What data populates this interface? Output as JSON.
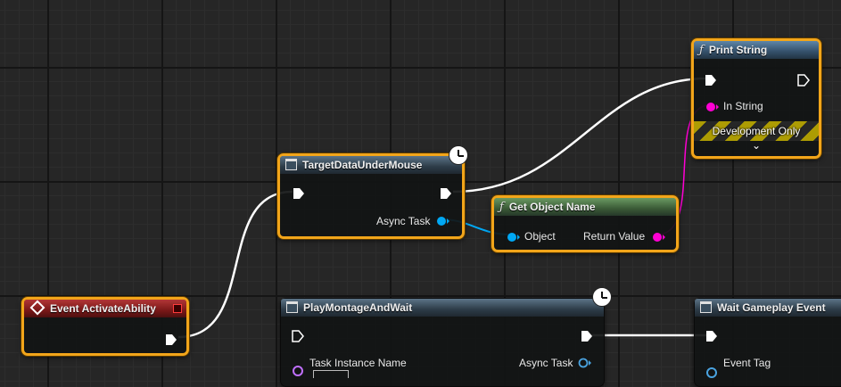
{
  "nodes": {
    "print_string": {
      "title": "Print String",
      "pin_in_string": "In String",
      "dev_only": "Development Only"
    },
    "target_data": {
      "title": "TargetDataUnderMouse",
      "pin_async_task": "Async Task"
    },
    "get_object_name": {
      "title": "Get Object Name",
      "pin_object": "Object",
      "pin_return": "Return Value"
    },
    "event_activate": {
      "title": "Event ActivateAbility"
    },
    "play_montage": {
      "title": "PlayMontageAndWait",
      "pin_task_instance": "Task Instance Name",
      "pin_async_task": "Async Task"
    },
    "wait_gameplay": {
      "title": "Wait Gameplay Event",
      "pin_event_tag": "Event Tag"
    }
  },
  "colors": {
    "selection": "#f2a51a",
    "exec_wire": "#ffffff",
    "object_pin": "#00a8f4",
    "string_pin": "#ff00d4",
    "task_pin": "#4aa3e0",
    "name_pin": "#c070ff"
  },
  "icons": {
    "function": "function-icon",
    "task": "task-icon",
    "event": "event-icon",
    "latent": "clock-icon",
    "expand": "chevron-down-icon"
  }
}
